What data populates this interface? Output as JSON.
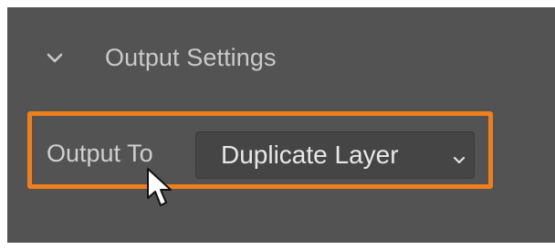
{
  "panel": {
    "section_title": "Output Settings",
    "section_icon": "chevron-down-icon",
    "output_to": {
      "label": "Output To",
      "selected_value": "Duplicate Layer",
      "dropdown_icon": "chevron-down-icon"
    },
    "highlight_color": "#ef7f1a",
    "background_color": "#535353"
  },
  "cursor": {
    "icon": "mouse-pointer-icon"
  }
}
